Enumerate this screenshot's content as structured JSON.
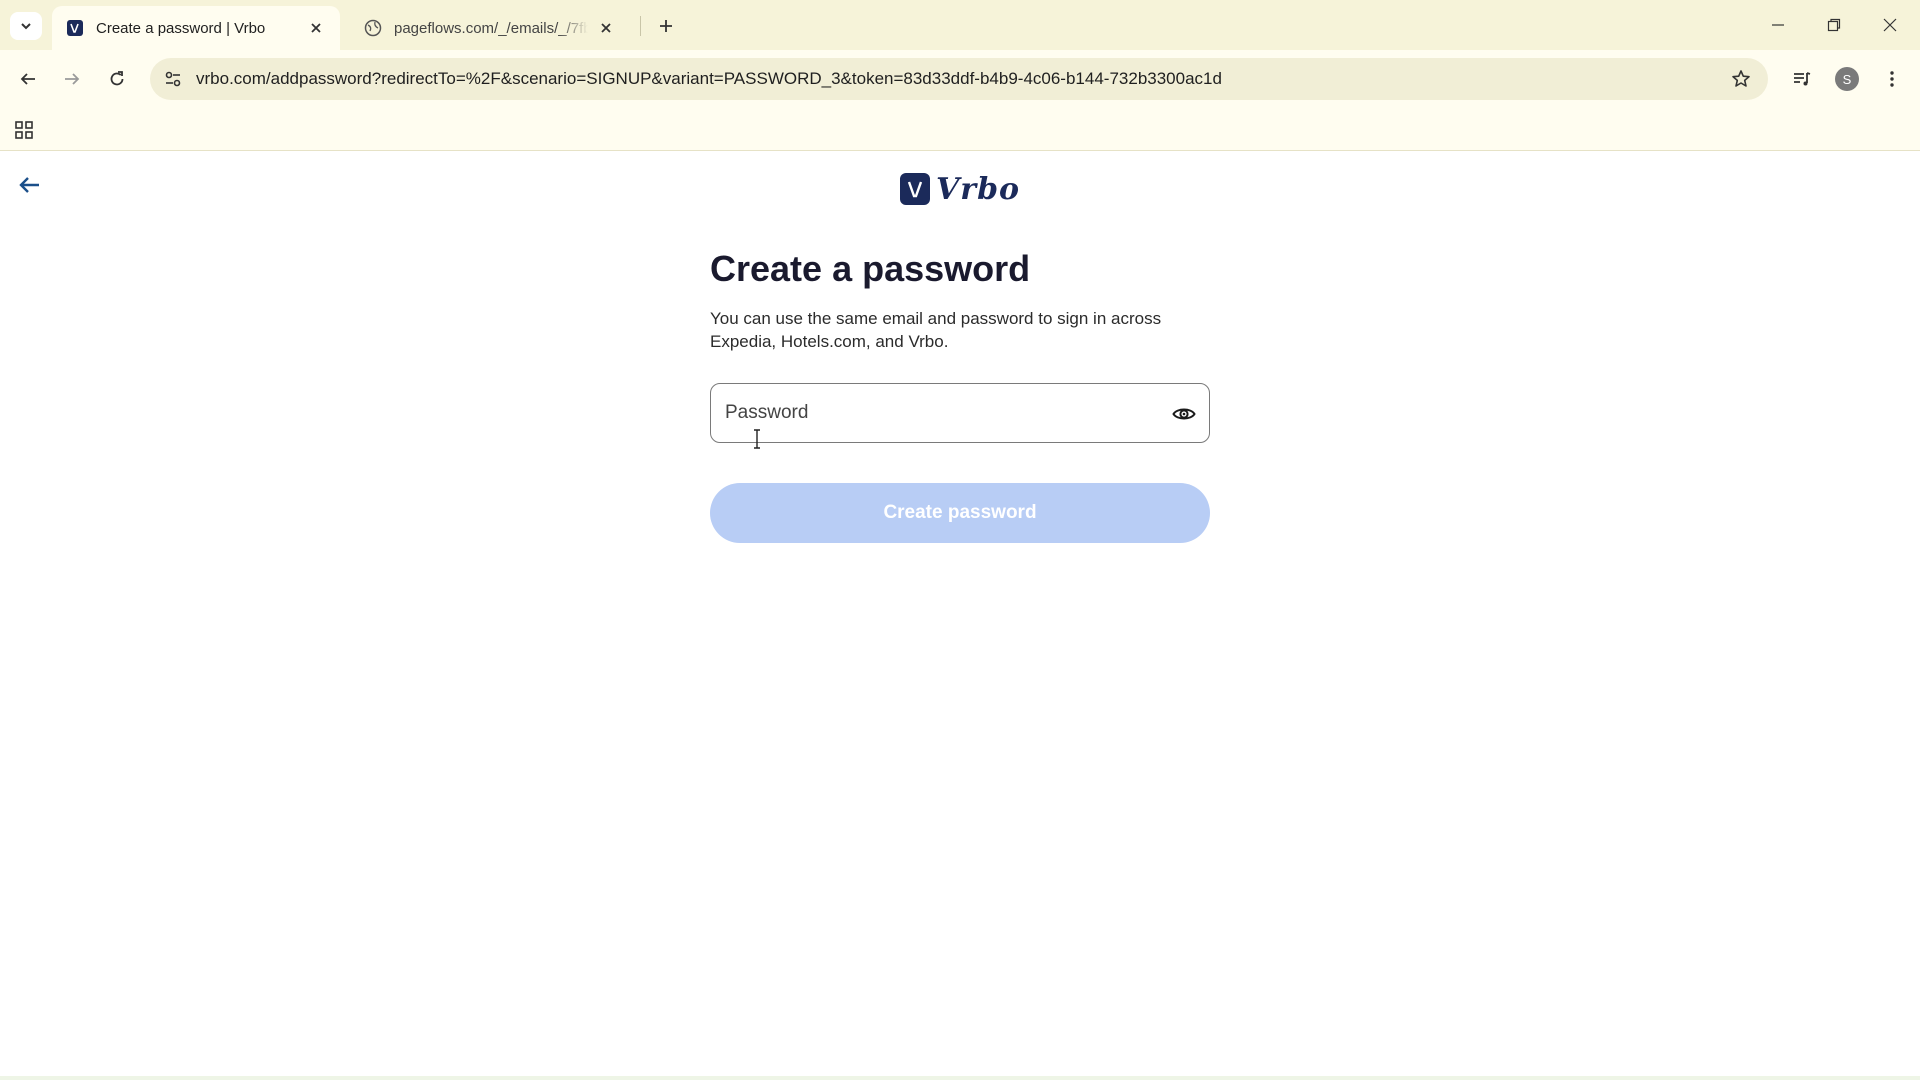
{
  "browser": {
    "tabs": [
      {
        "title": "Create a password | Vrbo",
        "active": true
      },
      {
        "title": "pageflows.com/_/emails/_/7fb5",
        "active": false
      }
    ],
    "url": "vrbo.com/addpassword?redirectTo=%2F&scenario=SIGNUP&variant=PASSWORD_3&token=83d33ddf-b4b9-4c06-b144-732b3300ac1d",
    "profile_initial": "S"
  },
  "page": {
    "logo_text": "Vrbo",
    "heading": "Create a password",
    "subtext": "You can use the same email and password to sign in across Expedia, Hotels.com, and Vrbo.",
    "password_field": {
      "placeholder": "Password",
      "value": ""
    },
    "submit_label": "Create password"
  },
  "colors": {
    "brand_navy": "#1b2a5a",
    "button_disabled": "#b8cdf5",
    "chrome_bg": "#f6f3d9"
  }
}
